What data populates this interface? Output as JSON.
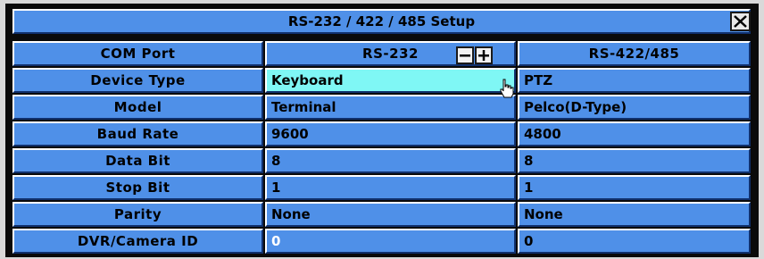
{
  "dialog": {
    "title": "RS-232 / 422 / 485 Setup"
  },
  "header": {
    "label": "COM Port",
    "col1": "RS-232",
    "col2": "RS-422/485"
  },
  "rows": [
    {
      "label": "Device Type",
      "col1": "Keyboard",
      "col2": "PTZ"
    },
    {
      "label": "Model",
      "col1": "Terminal",
      "col2": "Pelco(D-Type)"
    },
    {
      "label": "Baud Rate",
      "col1": "9600",
      "col2": "4800"
    },
    {
      "label": "Data Bit",
      "col1": "8",
      "col2": "8"
    },
    {
      "label": "Stop Bit",
      "col1": "1",
      "col2": "1"
    },
    {
      "label": "Parity",
      "col1": "None",
      "col2": "None"
    },
    {
      "label": "DVR/Camera ID",
      "col1": "0",
      "col2": "0"
    }
  ],
  "icons": {
    "close": "close-icon",
    "minus": "minus-icon",
    "plus": "plus-icon",
    "cursor": "hand-pointer-icon"
  },
  "colors": {
    "cell_blue": "#4f90e8",
    "selected_cyan": "#7ff7f5",
    "background": "#0a0a0a"
  }
}
